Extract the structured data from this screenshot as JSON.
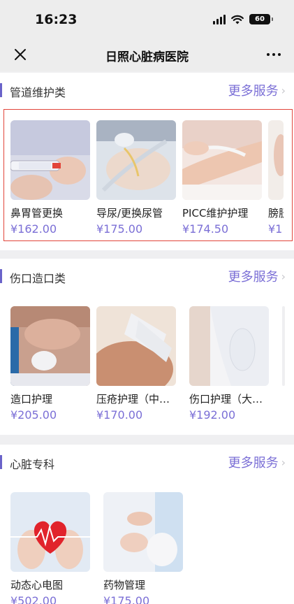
{
  "status": {
    "time": "16:23",
    "battery": "60"
  },
  "nav": {
    "title": "日照心脏病医院"
  },
  "sections": [
    {
      "title": "管道维护类",
      "more": "更多服务",
      "items": [
        {
          "name": "鼻胃管更换",
          "price": "¥162.00"
        },
        {
          "name": "导尿/更换尿管",
          "price": "¥175.00"
        },
        {
          "name": "PICC维护护理",
          "price": "¥174.50"
        },
        {
          "name": "膀胱",
          "price": "¥1"
        }
      ]
    },
    {
      "title": "伤口造口类",
      "more": "更多服务",
      "items": [
        {
          "name": "造口护理",
          "price": "¥205.00"
        },
        {
          "name": "压疮护理（中…",
          "price": "¥170.00"
        },
        {
          "name": "伤口护理（大…",
          "price": "¥192.00"
        }
      ]
    },
    {
      "title": "心脏专科",
      "more": "更多服务",
      "items": [
        {
          "name": "动态心电图",
          "price": "¥502.00"
        },
        {
          "name": "药物管理",
          "price": "¥175.00"
        }
      ]
    }
  ],
  "colors": {
    "accent": "#7b6fd6",
    "section_bar": "#6a63c9",
    "highlight": "#e2453a"
  }
}
